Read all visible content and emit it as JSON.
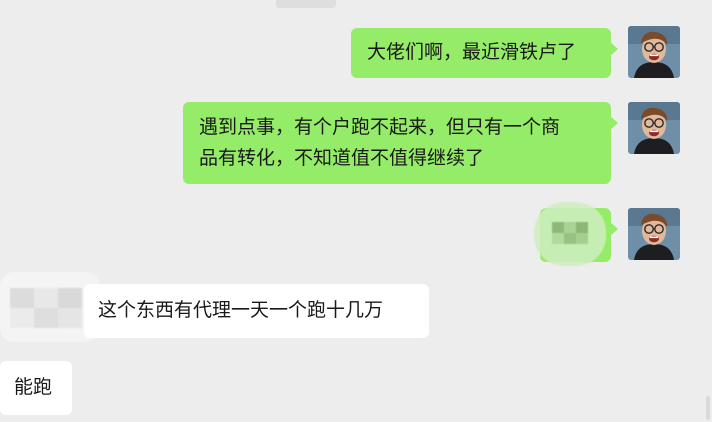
{
  "messages": [
    {
      "side": "out",
      "text": "大佬们啊，最近滑铁卢了"
    },
    {
      "side": "out",
      "lines": [
        "遇到点事，有个户跑不起来，但只有一个商",
        "品有转化，不知道值不值得继续了"
      ]
    },
    {
      "side": "out",
      "text": "",
      "redacted": true
    },
    {
      "side": "in",
      "text": "这个东西有代理一天一个跑十几万"
    },
    {
      "side": "in",
      "text": "能跑"
    }
  ],
  "colors": {
    "background": "#ededed",
    "outgoing_bubble": "#95ec69",
    "incoming_bubble": "#ffffff",
    "text": "#191919"
  },
  "avatar_icon": "user-photo-icon"
}
